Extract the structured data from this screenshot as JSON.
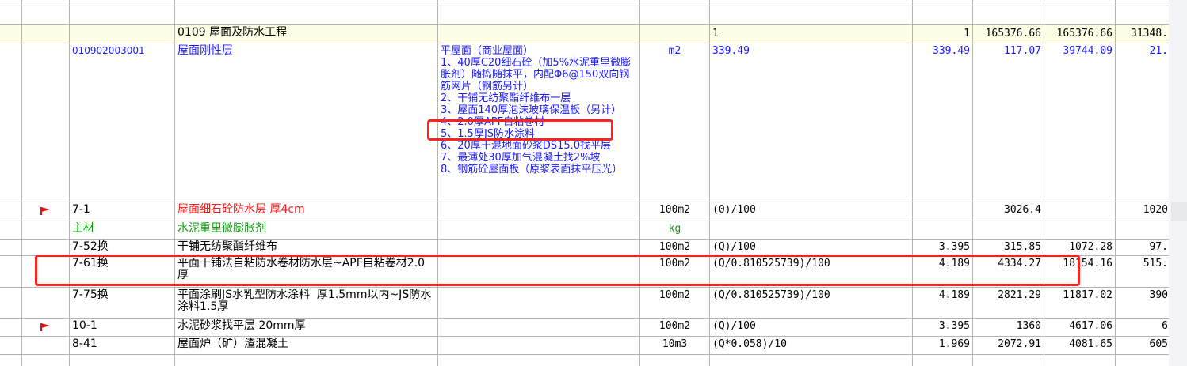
{
  "colors": {
    "accent_blue": "#1a1aff",
    "red": "#ff1a1a",
    "green": "#119911",
    "section_bg": "#fefee6",
    "highlight": "#ff2020"
  },
  "section": {
    "code": "0109 屋面及防水工程",
    "qty": "1",
    "c7": "1",
    "c8": "165376.66",
    "c9": "165376.66",
    "c10": "31348."
  },
  "item": {
    "code": "010902003001",
    "name": "屋面刚性层",
    "description": "平屋面（商业屋面）\n1、40厚C20细石砼（加5%水泥重里微膨胀剂）随捣随抹平，内配Φ6@150双向钢筋网片（钢筋另计）\n2、干铺无纺聚酯纤维布一层\n3、屋面140厚泡沫玻璃保温板（另计）\n4、2.0厚APF自粘卷材\n5、1.5厚JS防水涂料\n6、20厚干混地面砂浆DS15.0找平层\n7、最薄处30厚加气混凝土找2%坡\n8、钢筋砼屋面板（原浆表面抹平压光）",
    "unit": "m2",
    "expr": "339.49",
    "qty": "339.49",
    "price": "117.07",
    "total": "39744.09",
    "c10": "21."
  },
  "rows": [
    {
      "flag": true,
      "code": "7-1",
      "name": "屋面细石砼防水层 厚4cm",
      "unit": "100m2",
      "expr": "(0)/100",
      "qty": "",
      "price": "3026.4",
      "total": "",
      "c10": "1020",
      "color": "red"
    },
    {
      "flag": false,
      "code": "主材",
      "name": "水泥重里微膨胀剂",
      "unit": "kg",
      "expr": "",
      "qty": "",
      "price": "",
      "total": "",
      "c10": "",
      "color": "green"
    },
    {
      "flag": false,
      "code": "7-52换",
      "name": "干铺无纺聚酯纤维布",
      "unit": "100m2",
      "expr": "(Q)/100",
      "qty": "3.395",
      "price": "315.85",
      "total": "1072.28",
      "c10": "97.",
      "color": ""
    },
    {
      "flag": false,
      "code": "7-61换",
      "name": "平面干铺法自粘防水卷材防水层~APF自粘卷材2.0厚",
      "unit": "100m2",
      "expr": "(Q/0.810525739)/100",
      "qty": "4.189",
      "price": "4334.27",
      "total": "18154.16",
      "c10": "515.",
      "color": ""
    },
    {
      "flag": false,
      "code": "7-75换",
      "name": "平面涂刷JS水乳型防水涂料  厚1.5mm以内~JS防水涂料1.5厚",
      "unit": "100m2",
      "expr": "(Q/0.810525739)/100",
      "qty": "4.189",
      "price": "2821.29",
      "total": "11817.02",
      "c10": "390",
      "color": ""
    },
    {
      "flag": true,
      "code": "10-1",
      "name": "水泥砂浆找平层 20mm厚",
      "unit": "100m2",
      "expr": "(Q)/100",
      "qty": "3.395",
      "price": "1360",
      "total": "4617.06",
      "c10": "6",
      "color": ""
    },
    {
      "flag": false,
      "code": "8-41",
      "name": "屋面炉（矿）渣混凝土",
      "unit": "10m3",
      "expr": "(Q*0.058)/10",
      "qty": "1.969",
      "price": "2072.91",
      "total": "4081.65",
      "c10": "605",
      "color": ""
    }
  ]
}
